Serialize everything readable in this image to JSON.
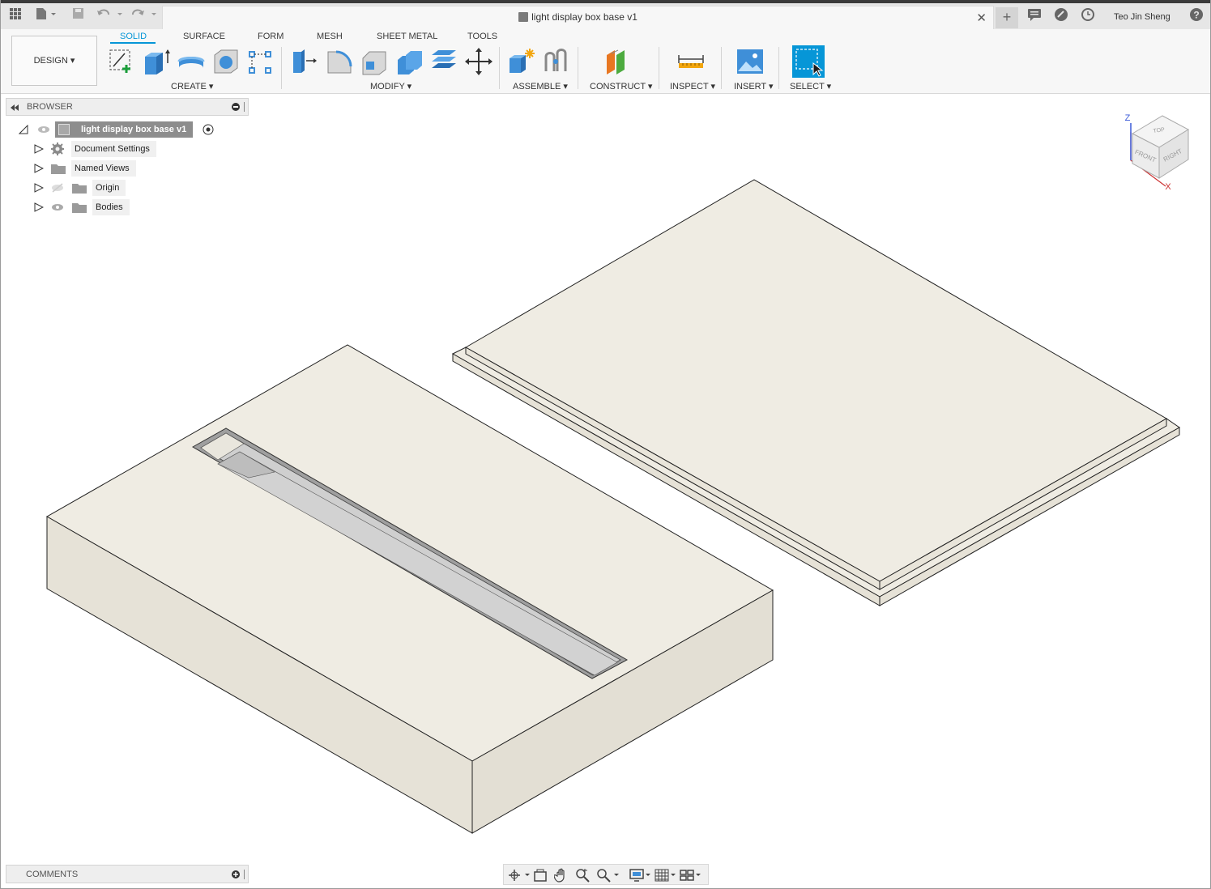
{
  "titlebar": {
    "document_title": "light display box base v1",
    "user_name": "Teo Jin Sheng",
    "new_tab_label": "+",
    "close_label": "✕",
    "help_label": "?"
  },
  "toolbar": {
    "workspace_button": "DESIGN ▾",
    "tabs": [
      {
        "label": "SOLID",
        "active": true
      },
      {
        "label": "SURFACE",
        "active": false
      },
      {
        "label": "FORM",
        "active": false
      },
      {
        "label": "MESH",
        "active": false
      },
      {
        "label": "SHEET METAL",
        "active": false
      },
      {
        "label": "TOOLS",
        "active": false
      }
    ],
    "groups": {
      "create": "CREATE ▾",
      "modify": "MODIFY ▾",
      "assemble": "ASSEMBLE ▾",
      "construct": "CONSTRUCT ▾",
      "inspect": "INSPECT ▾",
      "insert": "INSERT ▾",
      "select": "SELECT ▾"
    }
  },
  "browser": {
    "title": "BROWSER",
    "root": "light display box base v1",
    "items": [
      {
        "label": "Document Settings",
        "icon": "gear-icon"
      },
      {
        "label": "Named Views",
        "icon": "folder-icon"
      },
      {
        "label": "Origin",
        "icon": "folder-icon",
        "visibility": "hidden"
      },
      {
        "label": "Bodies",
        "icon": "folder-icon",
        "visibility": "visible"
      }
    ]
  },
  "comments": {
    "title": "COMMENTS"
  },
  "viewcube": {
    "faces": [
      "TOP",
      "FRONT",
      "RIGHT"
    ],
    "axes": [
      "Z",
      "X"
    ]
  },
  "colors": {
    "accent": "#0696d7",
    "model_top": "#efece3",
    "model_side": "#e6e2d7",
    "slot": "#cfcfcf"
  }
}
